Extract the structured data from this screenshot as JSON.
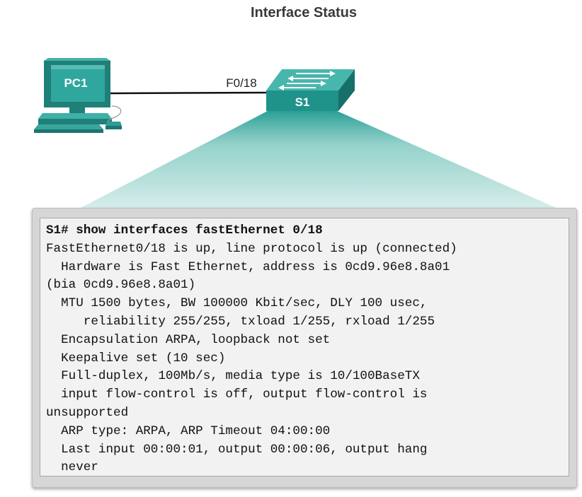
{
  "title": "Interface Status",
  "topology": {
    "pc_label": "PC1",
    "switch_label": "S1",
    "link_label": "F0/18"
  },
  "terminal": {
    "prompt": "S1# ",
    "command": "show interfaces fastEthernet 0/18",
    "output": [
      "FastEthernet0/18 is up, line protocol is up (connected)",
      "  Hardware is Fast Ethernet, address is 0cd9.96e8.8a01",
      "(bia 0cd9.96e8.8a01)",
      "  MTU 1500 bytes, BW 100000 Kbit/sec, DLY 100 usec,",
      "     reliability 255/255, txload 1/255, rxload 1/255",
      "  Encapsulation ARPA, loopback not set",
      "  Keepalive set (10 sec)",
      "  Full-duplex, 100Mb/s, media type is 10/100BaseTX",
      "  input flow-control is off, output flow-control is",
      "unsupported",
      "  ARP type: ARPA, ARP Timeout 04:00:00",
      "  Last input 00:00:01, output 00:00:06, output hang",
      "  never"
    ]
  },
  "colors": {
    "device_teal": "#2a9e96",
    "device_dark": "#1f7f79",
    "zoom_fill": "#b9e0dc"
  }
}
